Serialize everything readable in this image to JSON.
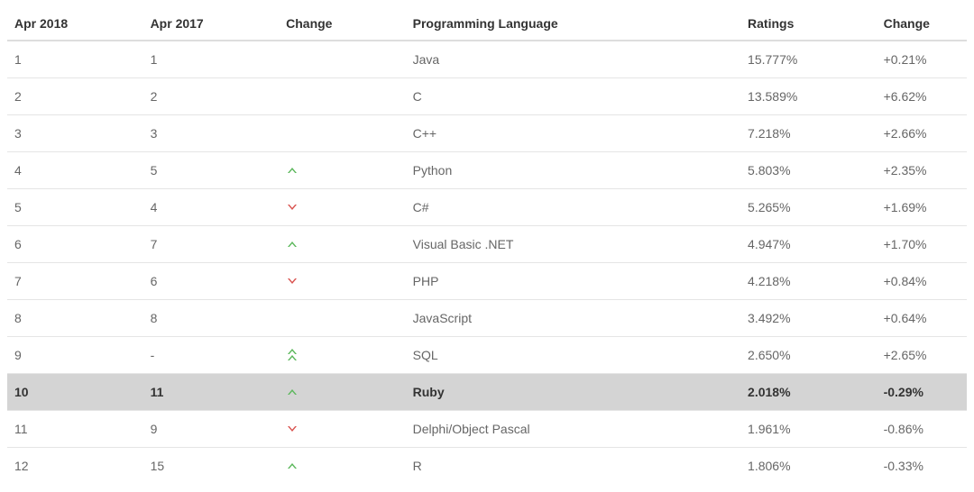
{
  "columns": {
    "apr2018": "Apr 2018",
    "apr2017": "Apr 2017",
    "change_icon": "Change",
    "language": "Programming Language",
    "ratings": "Ratings",
    "change_pct": "Change"
  },
  "rows": [
    {
      "apr2018": "1",
      "apr2017": "1",
      "change": "",
      "language": "Java",
      "ratings": "15.777%",
      "change_pct": "+0.21%",
      "highlight": false
    },
    {
      "apr2018": "2",
      "apr2017": "2",
      "change": "",
      "language": "C",
      "ratings": "13.589%",
      "change_pct": "+6.62%",
      "highlight": false
    },
    {
      "apr2018": "3",
      "apr2017": "3",
      "change": "",
      "language": "C++",
      "ratings": "7.218%",
      "change_pct": "+2.66%",
      "highlight": false
    },
    {
      "apr2018": "4",
      "apr2017": "5",
      "change": "up",
      "language": "Python",
      "ratings": "5.803%",
      "change_pct": "+2.35%",
      "highlight": false
    },
    {
      "apr2018": "5",
      "apr2017": "4",
      "change": "down",
      "language": "C#",
      "ratings": "5.265%",
      "change_pct": "+1.69%",
      "highlight": false
    },
    {
      "apr2018": "6",
      "apr2017": "7",
      "change": "up",
      "language": "Visual Basic .NET",
      "ratings": "4.947%",
      "change_pct": "+1.70%",
      "highlight": false
    },
    {
      "apr2018": "7",
      "apr2017": "6",
      "change": "down",
      "language": "PHP",
      "ratings": "4.218%",
      "change_pct": "+0.84%",
      "highlight": false
    },
    {
      "apr2018": "8",
      "apr2017": "8",
      "change": "",
      "language": "JavaScript",
      "ratings": "3.492%",
      "change_pct": "+0.64%",
      "highlight": false
    },
    {
      "apr2018": "9",
      "apr2017": "-",
      "change": "double-up",
      "language": "SQL",
      "ratings": "2.650%",
      "change_pct": "+2.65%",
      "highlight": false
    },
    {
      "apr2018": "10",
      "apr2017": "11",
      "change": "up",
      "language": "Ruby",
      "ratings": "2.018%",
      "change_pct": "-0.29%",
      "highlight": true
    },
    {
      "apr2018": "11",
      "apr2017": "9",
      "change": "down",
      "language": "Delphi/Object Pascal",
      "ratings": "1.961%",
      "change_pct": "-0.86%",
      "highlight": false
    },
    {
      "apr2018": "12",
      "apr2017": "15",
      "change": "up",
      "language": "R",
      "ratings": "1.806%",
      "change_pct": "-0.33%",
      "highlight": false
    }
  ],
  "chart_data": {
    "type": "table",
    "title": "Programming Language Ratings Apr 2018 vs Apr 2017",
    "columns": [
      "Apr 2018",
      "Apr 2017",
      "Change",
      "Programming Language",
      "Ratings",
      "Change"
    ],
    "rows": [
      [
        1,
        1,
        "",
        "Java",
        "15.777%",
        "+0.21%"
      ],
      [
        2,
        2,
        "",
        "C",
        "13.589%",
        "+6.62%"
      ],
      [
        3,
        3,
        "",
        "C++",
        "7.218%",
        "+2.66%"
      ],
      [
        4,
        5,
        "up",
        "Python",
        "5.803%",
        "+2.35%"
      ],
      [
        5,
        4,
        "down",
        "C#",
        "5.265%",
        "+1.69%"
      ],
      [
        6,
        7,
        "up",
        "Visual Basic .NET",
        "4.947%",
        "+1.70%"
      ],
      [
        7,
        6,
        "down",
        "PHP",
        "4.218%",
        "+0.84%"
      ],
      [
        8,
        8,
        "",
        "JavaScript",
        "3.492%",
        "+0.64%"
      ],
      [
        9,
        "-",
        "double-up",
        "SQL",
        "2.650%",
        "+2.65%"
      ],
      [
        10,
        11,
        "up",
        "Ruby",
        "2.018%",
        "-0.29%"
      ],
      [
        11,
        9,
        "down",
        "Delphi/Object Pascal",
        "1.961%",
        "-0.86%"
      ],
      [
        12,
        15,
        "up",
        "R",
        "1.806%",
        "-0.33%"
      ]
    ]
  }
}
